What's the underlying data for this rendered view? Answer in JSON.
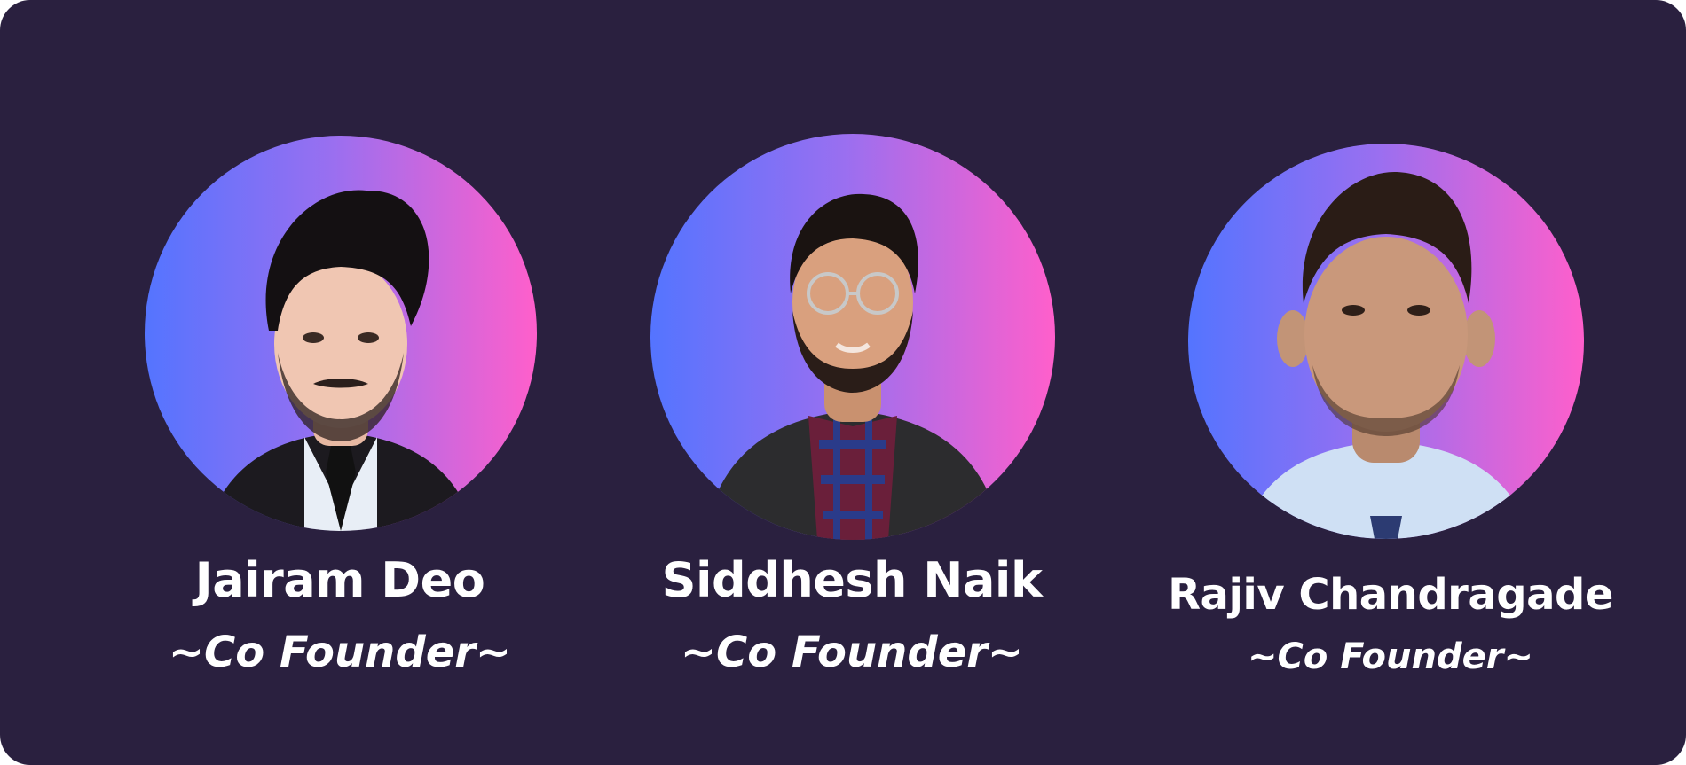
{
  "team": {
    "members": [
      {
        "name": "Jairam Deo",
        "role": "~Co Founder~"
      },
      {
        "name": "Siddhesh Naik",
        "role": "~Co Founder~"
      },
      {
        "name": "Rajiv Chandragade",
        "role": "~Co Founder~"
      }
    ]
  },
  "colors": {
    "background": "#2a203f",
    "gradient_start": "#5474ff",
    "gradient_end": "#ff5fcb",
    "text": "#ffffff"
  }
}
